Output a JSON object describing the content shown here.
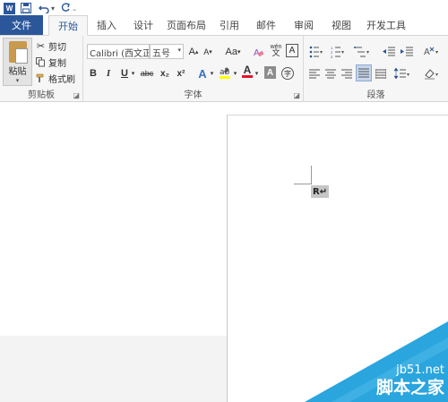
{
  "app": {
    "logo": "W"
  },
  "qat": {
    "save_icon": "save-icon",
    "undo_icon": "undo-icon",
    "redo_icon": "redo-icon"
  },
  "tabs": [
    {
      "label": "文件",
      "kind": "file"
    },
    {
      "label": "开始",
      "kind": "active"
    },
    {
      "label": "插入"
    },
    {
      "label": "设计"
    },
    {
      "label": "页面布局"
    },
    {
      "label": "引用"
    },
    {
      "label": "邮件"
    },
    {
      "label": "审阅"
    },
    {
      "label": "视图"
    },
    {
      "label": "开发工具"
    }
  ],
  "clipboard": {
    "paste_label": "粘贴",
    "cut_label": "剪切",
    "copy_label": "复制",
    "format_painter_label": "格式刷",
    "group_label": "剪贴板"
  },
  "font": {
    "name": "Calibri (西文正",
    "size": "五号",
    "group_label": "字体",
    "grow_label": "A",
    "shrink_label": "A",
    "case_label": "Aa",
    "bold": "B",
    "italic": "I",
    "underline": "U",
    "strike": "abc",
    "subscript": "x₂",
    "superscript": "x²",
    "phonetic": "wén",
    "char_border": "A",
    "effects": "A",
    "font_color": "A",
    "char_shading": "A",
    "enclose": "字"
  },
  "paragraph": {
    "group_label": "段落"
  },
  "document": {
    "selected_text": "R↵"
  },
  "watermark": {
    "line1": "jb51.net",
    "line2": "脚本之家"
  },
  "colors": {
    "accent": "#2b579a",
    "ribbon_bg": "#f6f6f6",
    "watermark": "#2aa5de",
    "highlight": "#ffff00",
    "font_red": "#e81123"
  }
}
